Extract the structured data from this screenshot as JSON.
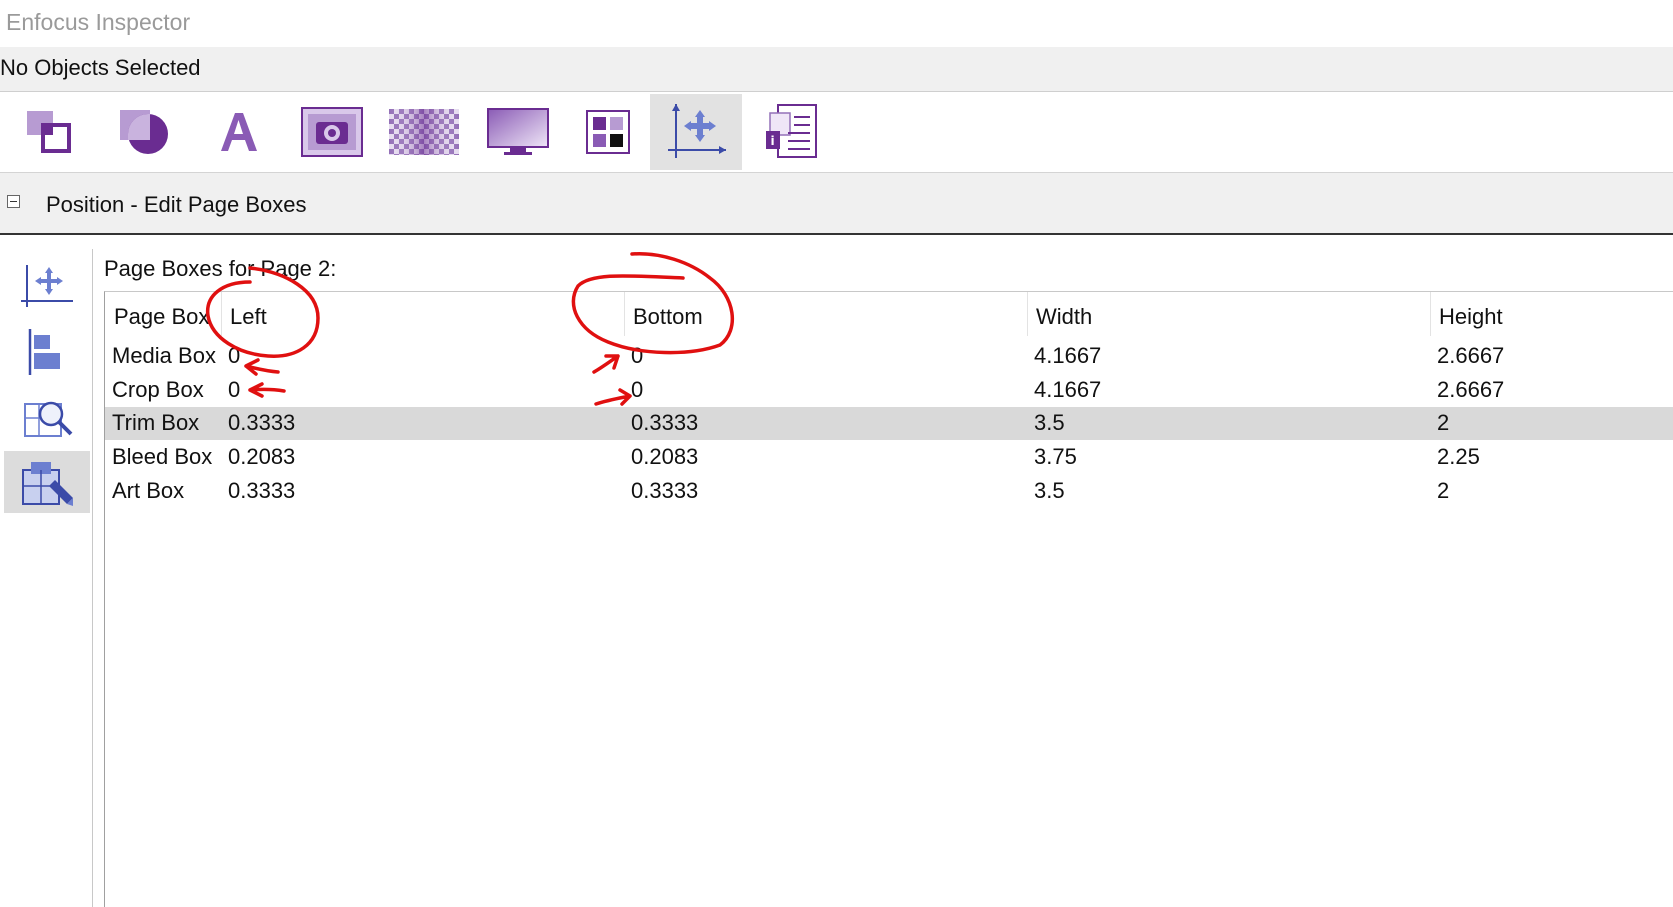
{
  "window": {
    "title": "Enfocus Inspector"
  },
  "selection": {
    "status": "No Objects Selected"
  },
  "toolbar": {
    "items": [
      {
        "icon": "object-arrange-icon",
        "label": ""
      },
      {
        "icon": "shape-fill-icon",
        "label": ""
      },
      {
        "icon": "text-icon",
        "label": ""
      },
      {
        "icon": "image-camera-icon",
        "label": ""
      },
      {
        "icon": "transparency-icon",
        "label": ""
      },
      {
        "icon": "display-monitor-icon",
        "label": ""
      },
      {
        "icon": "color-swatches-icon",
        "label": ""
      },
      {
        "icon": "position-icon",
        "label": "",
        "active": true
      },
      {
        "icon": "document-info-icon",
        "label": ""
      }
    ]
  },
  "section": {
    "title": "Position - Edit Page Boxes"
  },
  "sidebar": {
    "items": [
      {
        "icon": "move-icon"
      },
      {
        "icon": "align-icon"
      },
      {
        "icon": "page-zoom-icon"
      },
      {
        "icon": "edit-page-boxes-icon",
        "active": true
      }
    ]
  },
  "panel": {
    "label": "Page Boxes for Page 2:",
    "columns": [
      "Page Box",
      "Left",
      "Bottom",
      "Width",
      "Height"
    ],
    "rows": [
      {
        "name": "Media Box",
        "left": "0",
        "bottom": "0",
        "width": "4.1667",
        "height": "2.6667"
      },
      {
        "name": "Crop Box",
        "left": "0",
        "bottom": "0",
        "width": "4.1667",
        "height": "2.6667"
      },
      {
        "name": "Trim Box",
        "left": "0.3333",
        "bottom": "0.3333",
        "width": "3.5",
        "height": "2",
        "selected": true
      },
      {
        "name": "Bleed Box",
        "left": "0.2083",
        "bottom": "0.2083",
        "width": "3.75",
        "height": "2.25"
      },
      {
        "name": "Art Box",
        "left": "0.3333",
        "bottom": "0.3333",
        "width": "3.5",
        "height": "2"
      }
    ]
  },
  "colors": {
    "accent_purple": "#6a2c91",
    "light_purple": "#b79bd2",
    "annotation_red": "#e01010"
  }
}
